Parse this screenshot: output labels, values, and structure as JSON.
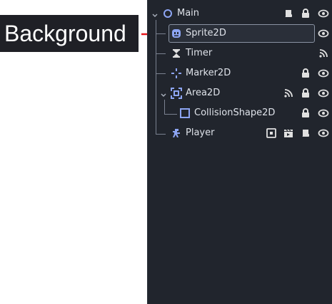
{
  "annotation": {
    "label": "Background",
    "arrow_color": "#e8171b"
  },
  "scene_tree": {
    "accent_color": "#8da5f3",
    "nodes": [
      {
        "name": "Main",
        "icon": "node-ring-icon",
        "expanded": true,
        "selected": false,
        "indicators": [
          "script-icon",
          "lock-icon",
          "eye-icon"
        ]
      },
      {
        "name": "Sprite2D",
        "icon": "sprite-icon",
        "selected": true,
        "indicators": [
          "eye-icon"
        ]
      },
      {
        "name": "Timer",
        "icon": "hourglass-icon",
        "selected": false,
        "indicators": [
          "signal-icon"
        ]
      },
      {
        "name": "Marker2D",
        "icon": "marker-icon",
        "selected": false,
        "indicators": [
          "lock-icon",
          "eye-icon"
        ]
      },
      {
        "name": "Area2D",
        "icon": "area-icon",
        "expanded": true,
        "selected": false,
        "indicators": [
          "signal-icon",
          "lock-icon",
          "eye-icon"
        ]
      },
      {
        "name": "CollisionShape2D",
        "icon": "collision-shape-icon",
        "selected": false,
        "indicators": [
          "lock-icon",
          "eye-icon"
        ]
      },
      {
        "name": "Player",
        "icon": "player-scene-icon",
        "selected": false,
        "indicators": [
          "open-scene-icon",
          "clapperboard-icon",
          "script-icon",
          "eye-icon"
        ]
      }
    ]
  }
}
